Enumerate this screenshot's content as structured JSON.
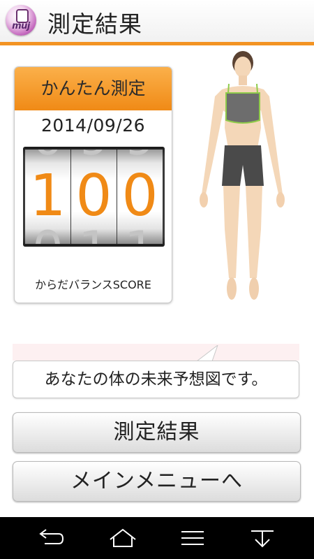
{
  "header": {
    "app_icon_text": "muj",
    "title": "測定結果"
  },
  "score_card": {
    "mode_label": "かんたん測定",
    "date": "2014/09/26",
    "digits": [
      "1",
      "0",
      "0"
    ],
    "caption": "からだバランスSCORE"
  },
  "message": "あなたの体の未来予想図です。",
  "buttons": {
    "result": "測定結果",
    "main_menu": "メインメニューへ"
  },
  "colors": {
    "accent_orange": "#f39322",
    "score_orange": "#f08a16",
    "nav_background": "#000000"
  },
  "navbar": {
    "icons": [
      "back-icon",
      "home-icon",
      "recent-apps-icon",
      "menu-icon"
    ]
  }
}
